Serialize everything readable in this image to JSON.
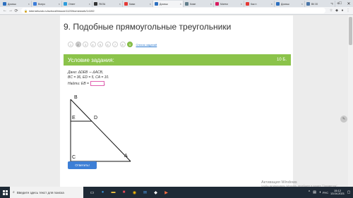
{
  "browser": {
    "tabs": [
      {
        "title": "Домаш",
        "color": "#2c6fbf",
        "active": false
      },
      {
        "title": "Вопро",
        "color": "#3b7dd8",
        "active": false
      },
      {
        "title": "Ответ",
        "color": "#2d9cdb",
        "active": false
      },
      {
        "title": "ЯКЛА",
        "color": "#333333",
        "active": false
      },
      {
        "title": "Ками",
        "color": "#e53935",
        "active": false
      },
      {
        "title": "Домаш",
        "color": "#2c6fbf",
        "active": true
      },
      {
        "title": "Комп",
        "color": "#607d8b",
        "active": false
      },
      {
        "title": "Матем",
        "color": "#d81b60",
        "active": false
      },
      {
        "title": "Как н",
        "color": "#e53935",
        "active": false
      },
      {
        "title": "Домаш",
        "color": "#2c6fbf",
        "active": false
      },
      {
        "title": "ВК 00",
        "color": "#4a76a8",
        "active": false
      }
    ],
    "url": "interneturok.ru/school/lesson/1120/homework/14192",
    "new_tab": "+"
  },
  "page": {
    "title": "9. Подобные прямоугольные треугольники",
    "pager": [
      {
        "label": "1",
        "state": "normal"
      },
      {
        "label": "2",
        "state": "current"
      },
      {
        "label": "3",
        "state": "normal"
      },
      {
        "label": "4",
        "state": "normal"
      },
      {
        "label": "5",
        "state": "normal"
      },
      {
        "label": "6",
        "state": "normal"
      },
      {
        "label": "7",
        "state": "normal"
      },
      {
        "label": "8",
        "state": "normal"
      },
      {
        "label": "9",
        "state": "done"
      }
    ],
    "tasks_link": "Список заданий",
    "header_title": "Условие задания:",
    "points": "10 Б.",
    "given_line1": "Дано: ΔDEB ∼ ΔACB,",
    "given_line2": "BC = 36, ED = 5, CA = 10.",
    "find_label": "Найти: EB =",
    "submit_label": "Ответить!",
    "diagram_labels": {
      "B": "B",
      "E": "E",
      "D": "D",
      "C": "C",
      "A": "A"
    }
  },
  "activation": {
    "title": "Активация Windows",
    "subtitle": "Чтобы активировать Windows, перейдите в раздел \"Параметры\"."
  },
  "taskbar": {
    "search_placeholder": "Введите здесь текст для поиска",
    "lang": "РУС",
    "time": "15:12",
    "date": "13.04.2021"
  },
  "colors": {
    "accent_green": "#8bc34a",
    "button_blue": "#3d7fd6",
    "taskbar": "#1f2a36"
  }
}
